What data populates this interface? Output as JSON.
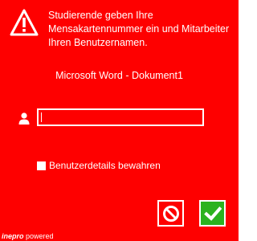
{
  "dialog": {
    "message": "Studierende geben Ihre Mensakartennummer ein und Mitarbeiter Ihren Benutzernamen.",
    "document_title": "Microsoft Word - Dokument1",
    "username_input": {
      "value": "",
      "placeholder": ""
    },
    "remember_checkbox": {
      "label": "Benutzerdetails bewahren",
      "checked": false
    },
    "buttons": {
      "cancel_icon": "no-entry-icon",
      "ok_icon": "checkmark-icon"
    },
    "footer": {
      "brand": "inepro",
      "suffix": "powered"
    }
  },
  "colors": {
    "background": "#fe0000",
    "ok": "#2bb21f",
    "text": "#ffffff"
  }
}
